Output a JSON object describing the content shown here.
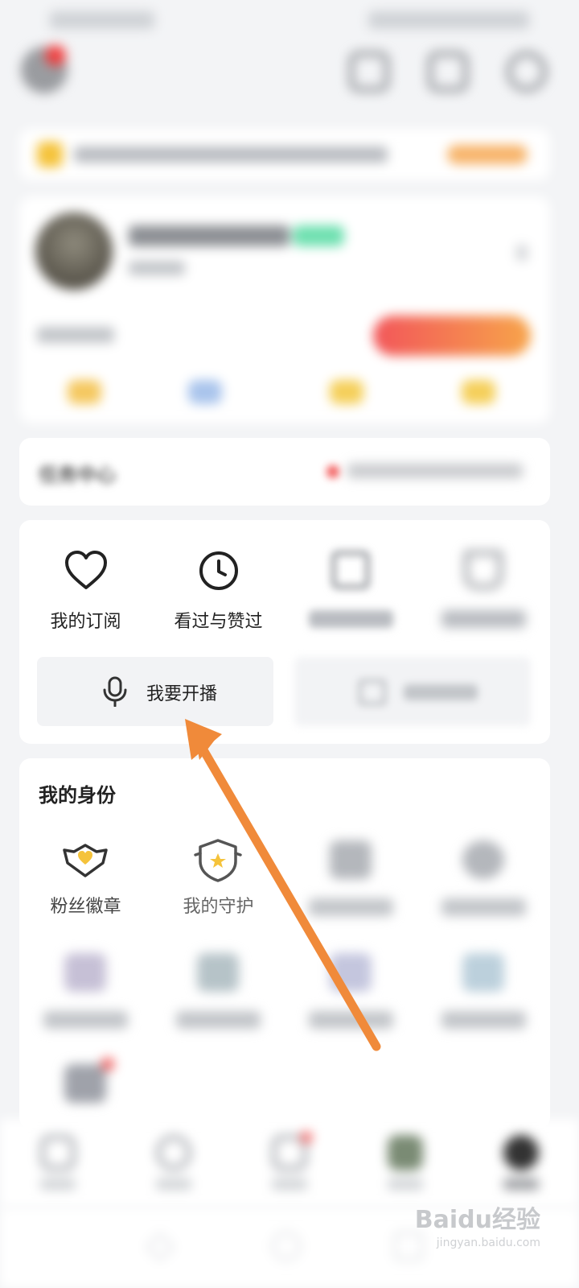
{
  "colors": {
    "background": "#f3f4f6",
    "card": "#ffffff",
    "accent_red": "#f25858",
    "accent_orange": "#f08a3a",
    "fan_badge_heart": "#f5c33b",
    "action_button_bg": "#f2f3f5"
  },
  "task_center": {
    "title": "任务中心"
  },
  "tools": {
    "items": [
      {
        "label": "我的订阅",
        "icon": "heart-icon"
      },
      {
        "label": "看过与赞过",
        "icon": "clock-icon"
      },
      {
        "label": "",
        "icon": "document-icon"
      },
      {
        "label": "",
        "icon": "cart-icon"
      }
    ],
    "go_live_label": "我要开播",
    "go_live_icon": "microphone-icon",
    "upload_icon": "upload-icon"
  },
  "identity": {
    "title": "我的身份",
    "items": [
      {
        "label": "粉丝徽章",
        "icon": "fan-badge-icon"
      },
      {
        "label": "我的守护",
        "icon": "guard-shield-icon"
      }
    ]
  },
  "annotation": {
    "type": "arrow",
    "color": "#f08a3a",
    "points_to": "我要开播"
  },
  "watermark": {
    "text": "Baidu经验",
    "url_text": "jingyan.baidu.com"
  }
}
